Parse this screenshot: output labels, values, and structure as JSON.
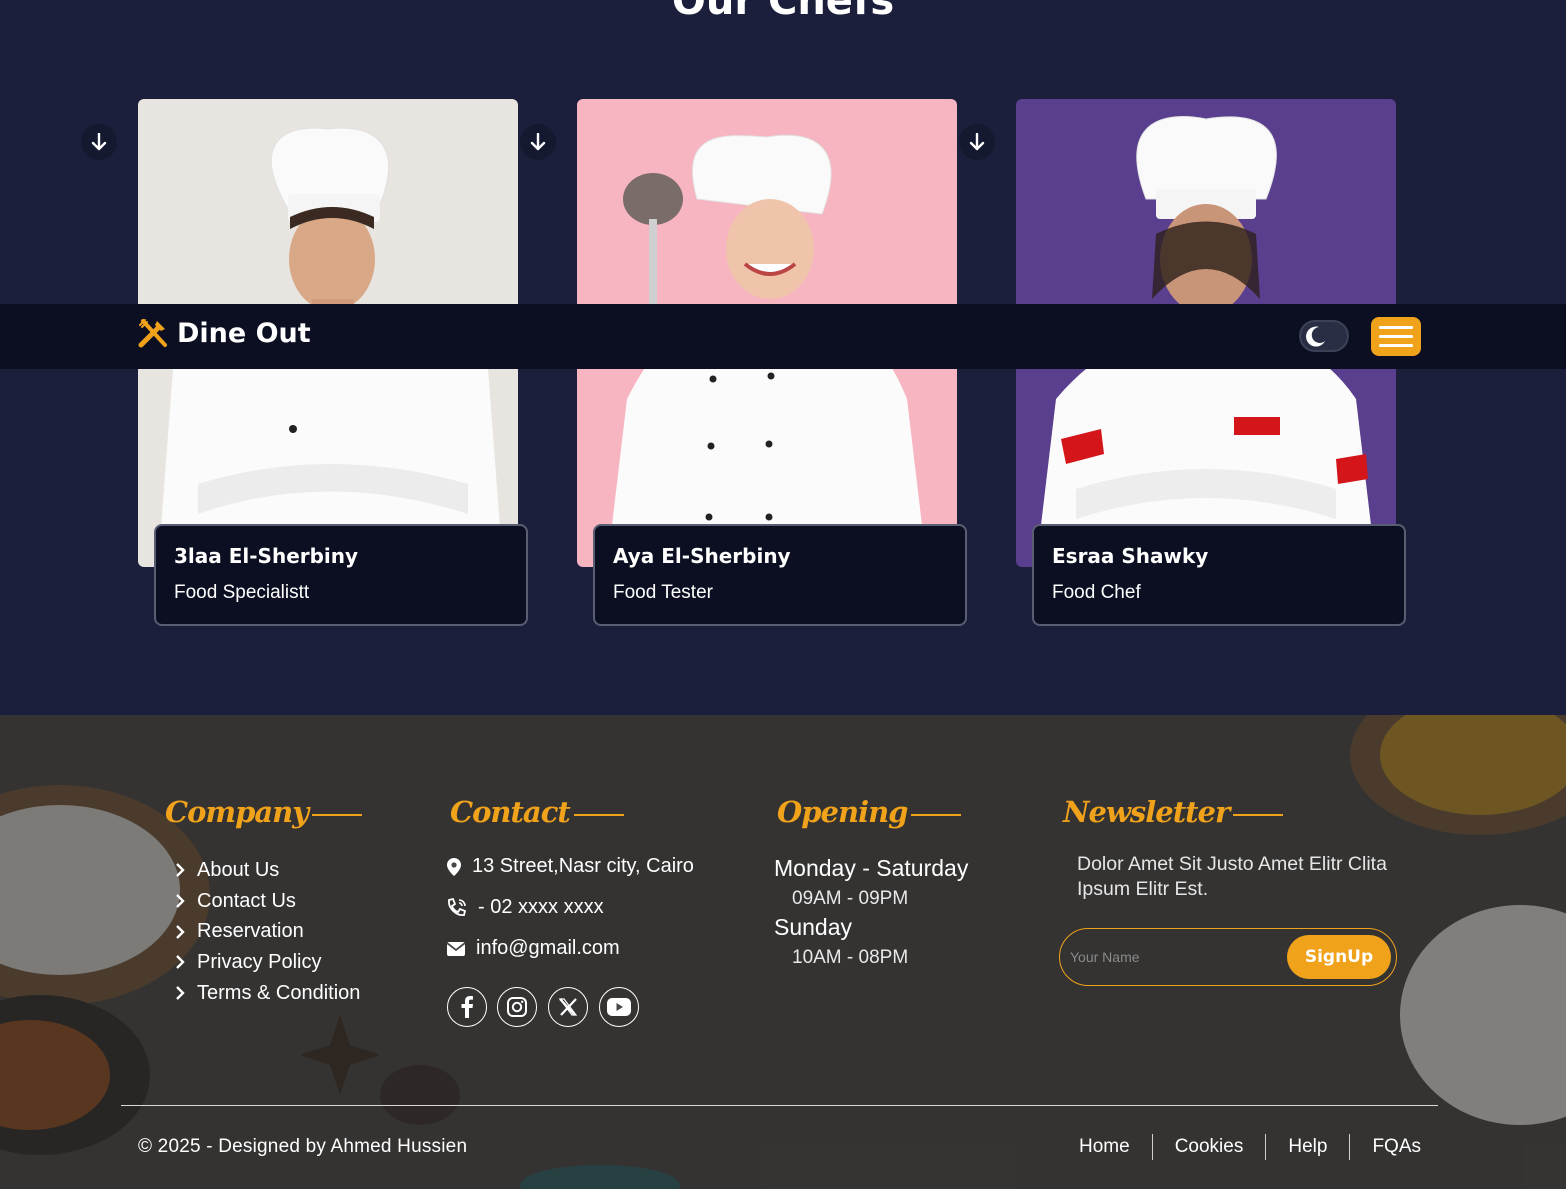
{
  "section": {
    "title": "Our Chefs"
  },
  "chefs": [
    {
      "name": "3laa El-Sherbiny",
      "role": "Food Specialistt",
      "photo_bg": "#e8e4df"
    },
    {
      "name": "Aya El-Sherbiny",
      "role": "Food Tester",
      "photo_bg": "#f7b4c1"
    },
    {
      "name": "Esraa Shawky",
      "role": "Food Chef",
      "photo_bg": "#5a3f8f"
    }
  ],
  "navbar": {
    "brand": "Dine Out",
    "logo_icon": "fork-knife-icon",
    "theme_icon": "moon-icon",
    "menu_icon": "hamburger-icon"
  },
  "footer": {
    "company": {
      "heading": "Company",
      "links": [
        "About Us",
        "Contact Us",
        "Reservation",
        "Privacy Policy",
        "Terms & Condition"
      ]
    },
    "contact": {
      "heading": "Contact",
      "address": "13 Street,Nasr city, Cairo",
      "phone": " - 02 xxxx xxxx",
      "email": "info@gmail.com",
      "socials": [
        "facebook-icon",
        "instagram-icon",
        "x-icon",
        "youtube-icon"
      ]
    },
    "opening": {
      "heading": "Opening",
      "day1": "Monday - Saturday",
      "time1": "09AM - 09PM",
      "day2": "Sunday",
      "time2": "10AM - 08PM"
    },
    "newsletter": {
      "heading": "Newsletter",
      "text": "Dolor Amet Sit Justo Amet Elitr Clita Ipsum Elitr Est.",
      "placeholder": "Your Name",
      "button": "SignUp"
    },
    "copyright": "© 2025 - Designed by Ahmed Hussien",
    "bottom_links": [
      "Home",
      "Cookies",
      "Help",
      "FQAs"
    ]
  },
  "colors": {
    "accent": "#f0a21b",
    "section_bg": "#1b1f3c",
    "navbar_bg": "#0b0f21"
  }
}
